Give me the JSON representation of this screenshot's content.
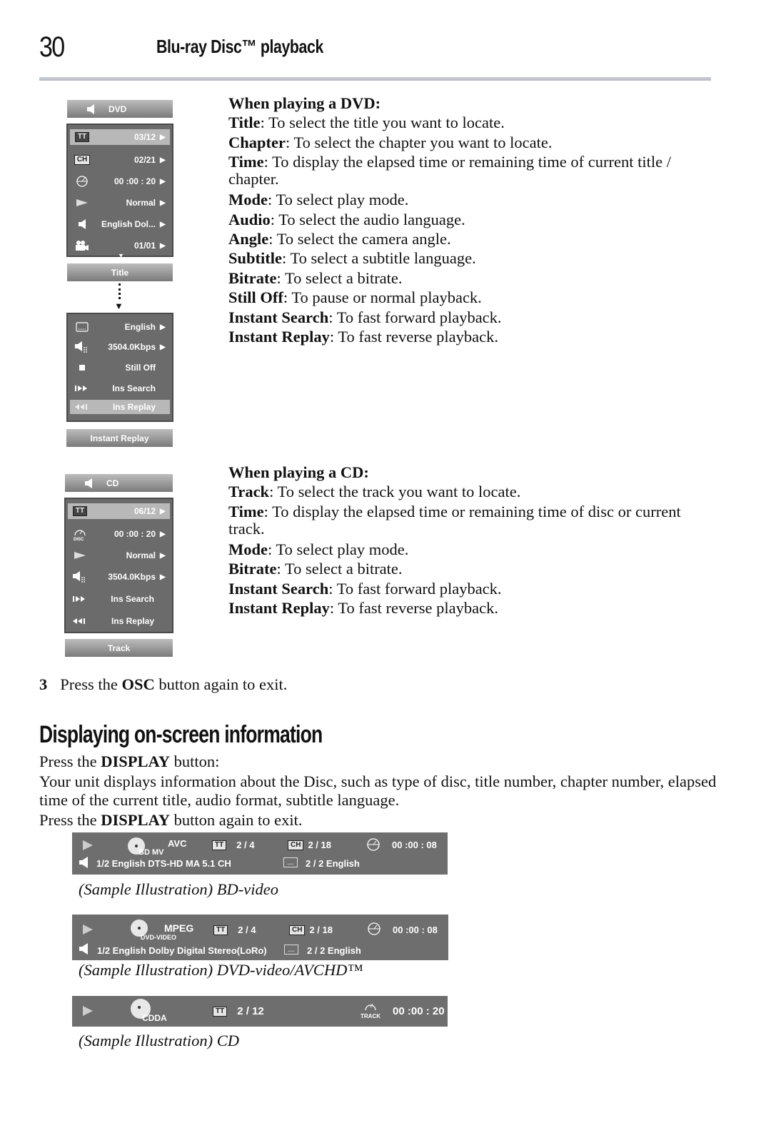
{
  "header": {
    "page_number": "30",
    "running_title": "Blu-ray Disc™ playback"
  },
  "dvd_osd": {
    "top_label": "DVD",
    "panel1_rows": [
      {
        "icon": "title-tt-icon",
        "icon_text": "TT",
        "value": "03/12",
        "selected": true
      },
      {
        "icon": "chapter-ch-icon",
        "icon_text": "CH",
        "value": "02/21"
      },
      {
        "icon": "time-clock-icon",
        "value": "00 :00 : 20"
      },
      {
        "icon": "play-mode-icon",
        "value": "Normal"
      },
      {
        "icon": "audio-speaker-icon",
        "value": "English Dol..."
      },
      {
        "icon": "camera-angle-icon",
        "value": "01/01"
      }
    ],
    "mid_label": "Title",
    "panel2_rows": [
      {
        "icon": "subtitle-icon",
        "value": "English"
      },
      {
        "icon": "bitrate-icon",
        "value": "3504.0Kbps"
      },
      {
        "icon": "still-stop-icon",
        "value": "Still Off"
      },
      {
        "icon": "instant-search-icon",
        "value": "Ins Search"
      },
      {
        "icon": "instant-replay-icon",
        "value": "Ins Replay",
        "selected": true
      }
    ],
    "bottom_label": "Instant Replay"
  },
  "dvd_desc": {
    "heading": "When playing a DVD:",
    "items": [
      {
        "term": "Title",
        "text": ": To select the title you want to locate."
      },
      {
        "term": "Chapter",
        "text": ": To select the chapter you want to locate."
      },
      {
        "term": "Time",
        "text": ": To display the elapsed time or remaining time of current title / chapter."
      },
      {
        "term": "Mode",
        "text": ": To select play mode."
      },
      {
        "term": "Audio",
        "text": ": To select the audio language."
      },
      {
        "term": "Angle",
        "text": ": To select the camera angle."
      },
      {
        "term": "Subtitle",
        "text": ": To select a subtitle language."
      },
      {
        "term": "Bitrate",
        "text": ": To select a bitrate."
      },
      {
        "term": "Still Off",
        "text": ": To pause or normal playback."
      },
      {
        "term": "Instant Search",
        "text": ": To fast forward playback."
      },
      {
        "term": "Instant Replay",
        "text": ": To fast reverse playback."
      }
    ]
  },
  "cd_osd": {
    "top_label": "CD",
    "rows": [
      {
        "icon": "title-tt-icon",
        "icon_text": "TT",
        "value": "06/12",
        "selected": true
      },
      {
        "icon": "disc-time-icon",
        "icon_text": "DISC",
        "value": "00 :00 : 20"
      },
      {
        "icon": "play-mode-icon",
        "value": "Normal"
      },
      {
        "icon": "bitrate-icon",
        "value": "3504.0Kbps"
      },
      {
        "icon": "instant-search-icon",
        "value": "Ins Search"
      },
      {
        "icon": "instant-replay-icon",
        "value": "Ins Replay"
      }
    ],
    "bottom_label": "Track"
  },
  "cd_desc": {
    "heading": "When playing a CD:",
    "items": [
      {
        "term": "Track",
        "text": ": To select the track you want to locate."
      },
      {
        "term": "Time",
        "text": ": To display the elapsed time or remaining time of disc or current track."
      },
      {
        "term": "Mode",
        "text": ": To select play mode."
      },
      {
        "term": "Bitrate",
        "text": ": To select a bitrate."
      },
      {
        "term": "Instant Search",
        "text": ": To fast forward playback."
      },
      {
        "term": "Instant Replay",
        "text": ": To fast reverse playback."
      }
    ]
  },
  "step3": {
    "number": "3",
    "pre": "Press the ",
    "bold": "OSC",
    "post": " button again to exit."
  },
  "section": {
    "heading": "Displaying on-screen information",
    "p1_pre": "Press the ",
    "p1_bold": "DISPLAY",
    "p1_post": " button:",
    "p2": "Your unit displays information about the Disc, such as type of disc, title number, chapter number, elapsed time of the current title, audio format, subtitle language.",
    "p3_pre": "Press the ",
    "p3_bold": "DISPLAY",
    "p3_post": " button again to exit."
  },
  "bars": {
    "bd": {
      "disc_label": "BD MV",
      "codec": "AVC",
      "tt_label": "TT",
      "title": "2 / 4",
      "ch_label": "CH",
      "chapter": "2 / 18",
      "time": "00 :00 : 08",
      "audio": "1/2 English DTS-HD MA 5.1 CH",
      "subtitle": "2 / 2  English",
      "caption": "(Sample Illustration) BD-video"
    },
    "dvd": {
      "disc_label": "DVD-VIDEO",
      "codec": "MPEG",
      "tt_label": "TT",
      "title": "2 / 4",
      "ch_label": "CH",
      "chapter": "2 / 18",
      "time": "00 :00 : 08",
      "audio": "1/2 English Dolby Digital Stereo(LoRo)",
      "subtitle": "2 / 2  English",
      "caption": "(Sample Illustration) DVD-video/AVCHD™"
    },
    "cd": {
      "disc_label": "CDDA",
      "tt_label": "TT",
      "title": "2 / 12",
      "track_label": "TRACK",
      "time": "00 :00 : 20",
      "caption": "(Sample Illustration) CD"
    }
  }
}
